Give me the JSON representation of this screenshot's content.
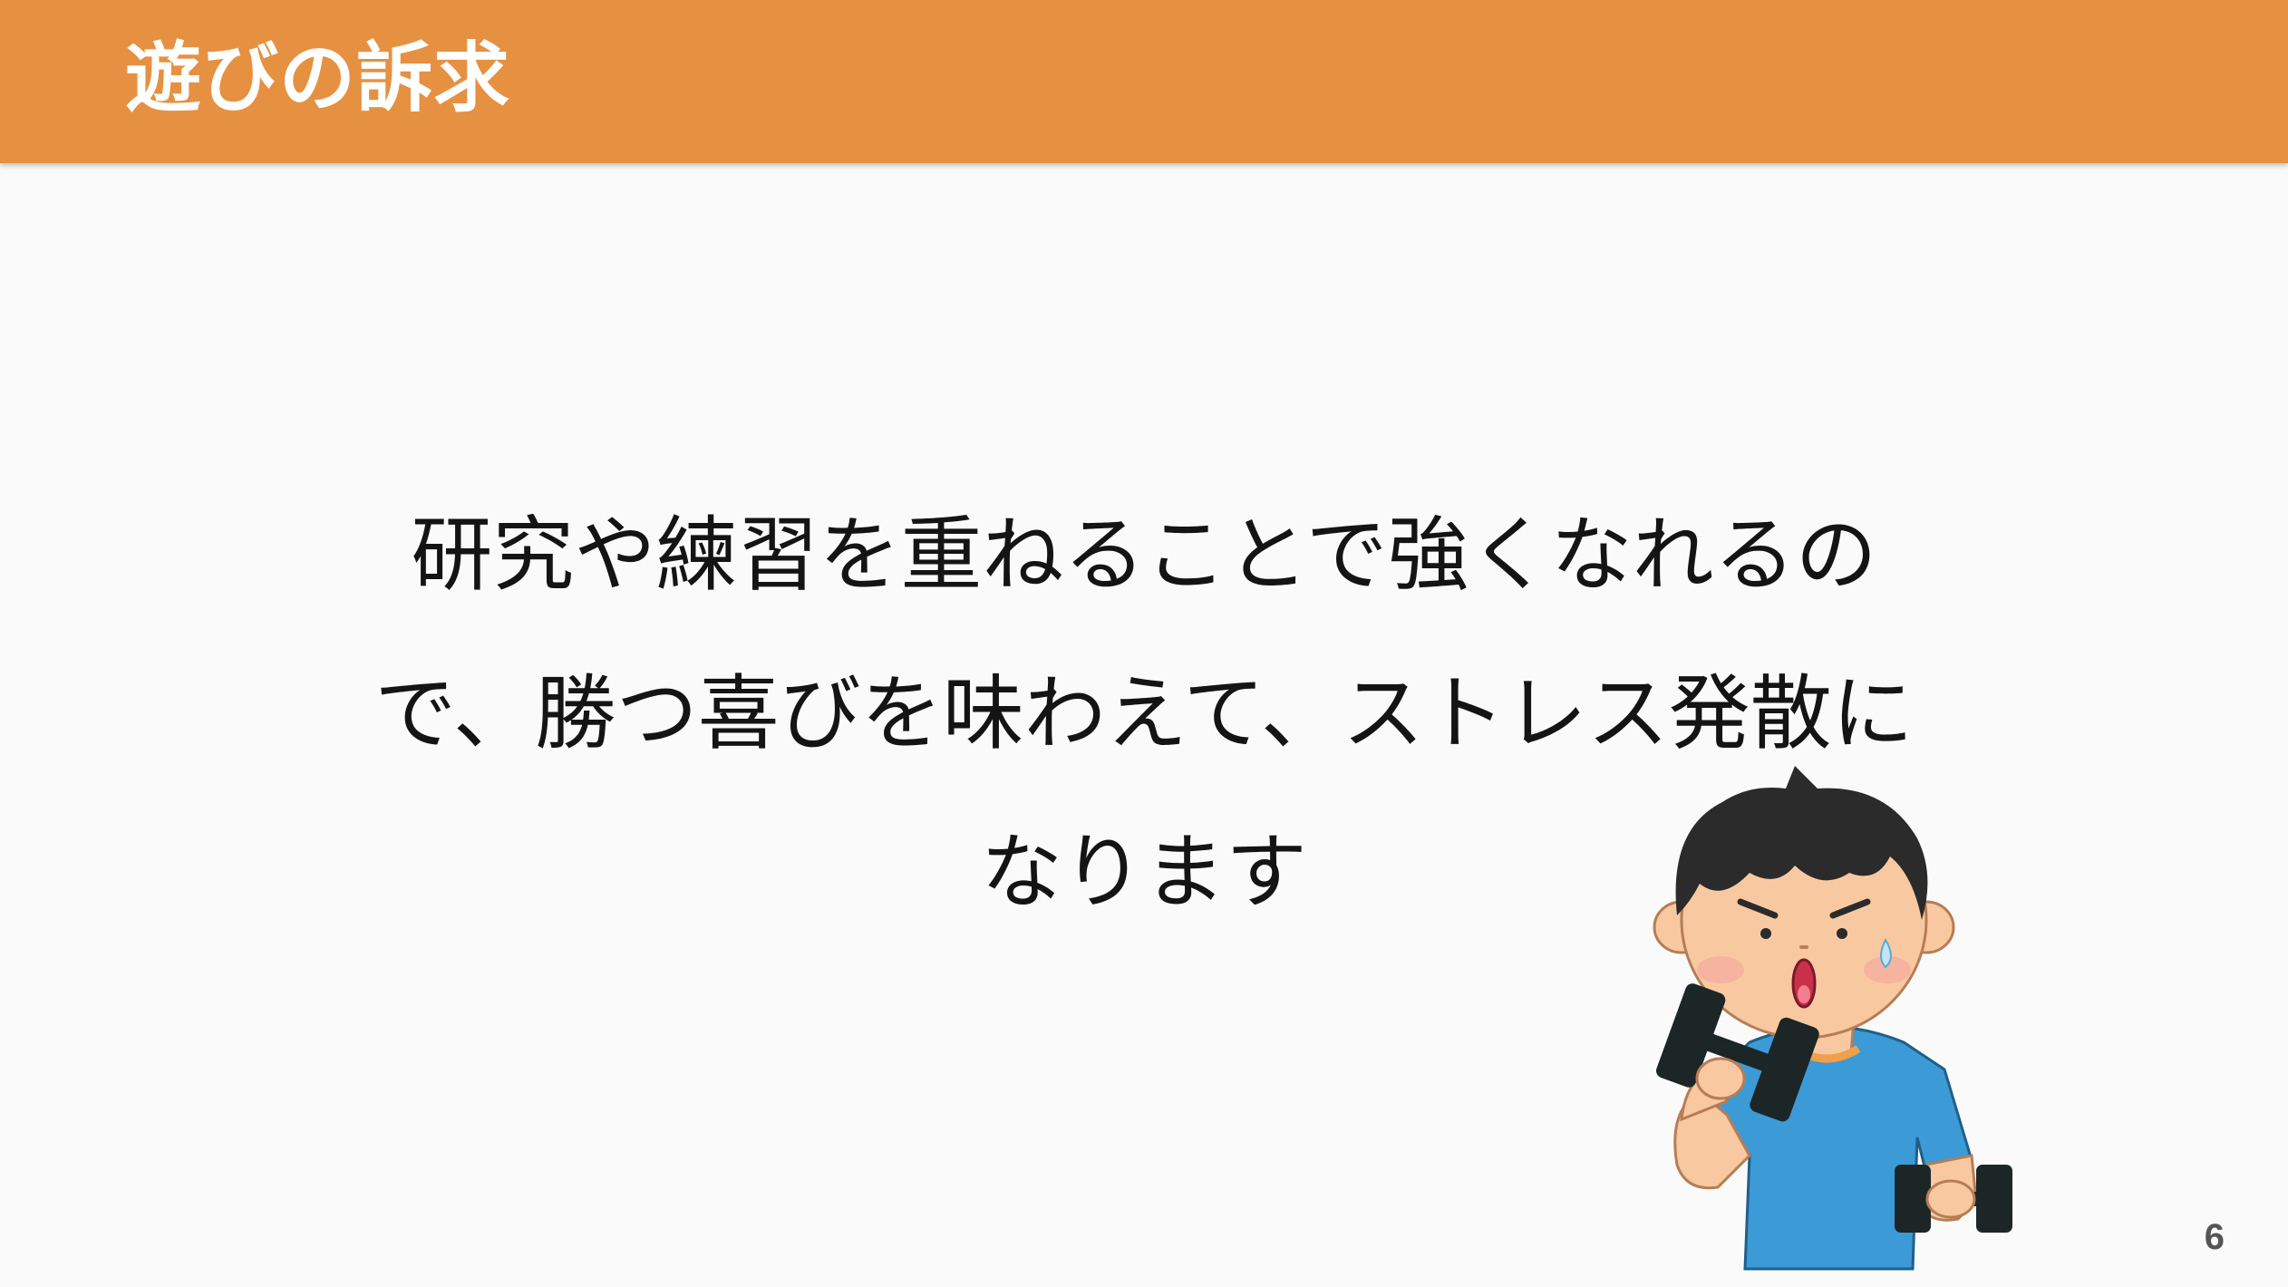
{
  "slide": {
    "title": "遊びの訴求",
    "body_lines": [
      "研究や練習を重ねることで強くなれるの",
      "で、勝つ喜びを味わえて、ストレス発散に",
      "なります"
    ],
    "page_number": "6"
  },
  "colors": {
    "header": "#e69142",
    "title_text": "#ffffff",
    "body_text": "#141414",
    "background": "#fafafa",
    "page_number": "#555555",
    "shirt": "#3c9ad6",
    "skin": "#f8c9a1",
    "hair": "#2b2b2b",
    "dumbbell": "#1d2626"
  },
  "illustration": {
    "icon": "man-lifting-dumbbells-icon"
  }
}
